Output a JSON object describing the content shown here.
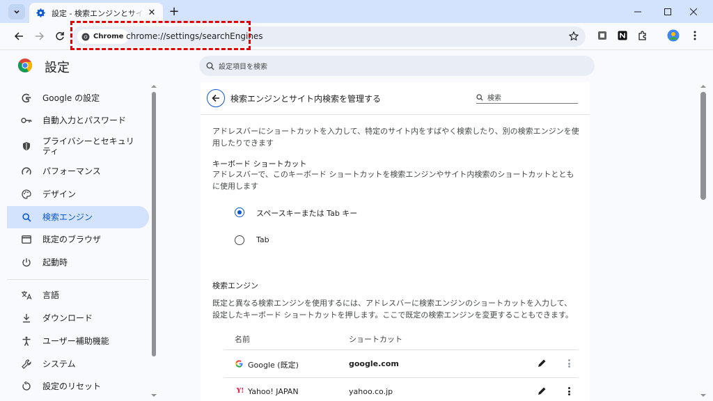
{
  "tab": {
    "title": "設定 - 検索エンジンとサイト内検索を管理する"
  },
  "toolbar": {
    "chip_label": "Chrome",
    "url": "chrome://settings/searchEngines"
  },
  "header": {
    "title": "設定",
    "search_placeholder": "設定項目を検索"
  },
  "sidebar": {
    "items": [
      {
        "label": "Google の設定",
        "icon": "google-g-icon"
      },
      {
        "label": "自動入力とパスワード",
        "icon": "key-icon"
      },
      {
        "label": "プライバシーとセキュリティ",
        "icon": "shield-icon"
      },
      {
        "label": "パフォーマンス",
        "icon": "gauge-icon"
      },
      {
        "label": "デザイン",
        "icon": "palette-icon"
      },
      {
        "label": "検索エンジン",
        "icon": "search-icon",
        "active": true
      },
      {
        "label": "既定のブラウザ",
        "icon": "browser-window-icon"
      },
      {
        "label": "起動時",
        "icon": "power-icon"
      },
      {
        "label": "言語",
        "icon": "translate-icon"
      },
      {
        "label": "ダウンロード",
        "icon": "download-icon"
      },
      {
        "label": "ユーザー補助機能",
        "icon": "accessibility-icon"
      },
      {
        "label": "システム",
        "icon": "wrench-icon"
      },
      {
        "label": "設定のリセット",
        "icon": "reset-icon"
      }
    ]
  },
  "main": {
    "title": "検索エンジンとサイト内検索を管理する",
    "search_placeholder": "検索",
    "intro": "アドレスバーにショートカットを入力して、特定のサイト内をすばやく検索したり、別の検索エンジンを使用したりできます",
    "keyboard_heading": "キーボード ショートカット",
    "keyboard_desc": "アドレスバーで、このキーボード ショートカットを検索エンジンやサイト内検索のショートカットとともに使用します",
    "radio_options": [
      {
        "label": "スペースキーまたは Tab キー",
        "checked": true
      },
      {
        "label": "Tab",
        "checked": false
      }
    ],
    "engines_heading": "検索エンジン",
    "engines_desc": "既定と異なる検索エンジンを使用するには、アドレスバーに検索エンジンのショートカットを入力して、設定したキーボード ショートカットを押します。ここで既定の検索エンジンを変更することもできます。",
    "columns": {
      "name": "名前",
      "shortcut": "ショートカット"
    },
    "engines": [
      {
        "name": "Google (既定)",
        "shortcut": "google.com"
      },
      {
        "name": "Yahoo! JAPAN",
        "shortcut": "yahoo.co.jp"
      }
    ]
  }
}
